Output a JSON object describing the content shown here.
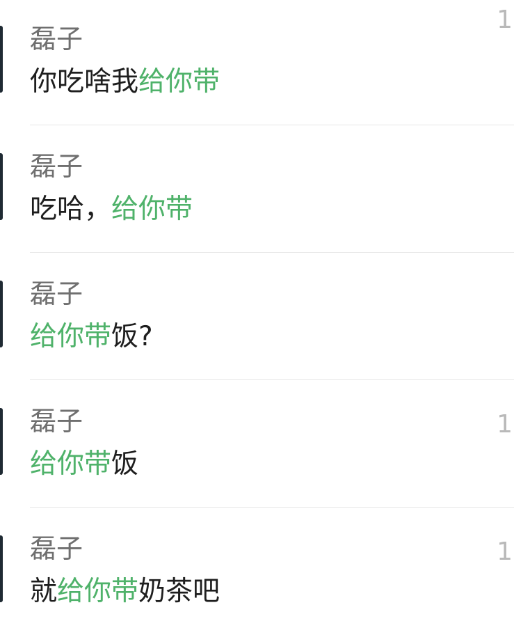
{
  "results": [
    {
      "sender": "磊子",
      "time": "1",
      "segments": [
        {
          "text": "你吃啥我",
          "highlight": false
        },
        {
          "text": "给你带",
          "highlight": true
        }
      ]
    },
    {
      "sender": "磊子",
      "time": "",
      "segments": [
        {
          "text": "吃哈，",
          "highlight": false
        },
        {
          "text": "给你带",
          "highlight": true
        }
      ]
    },
    {
      "sender": "磊子",
      "time": "",
      "segments": [
        {
          "text": "给你带",
          "highlight": true
        },
        {
          "text": "饭?",
          "highlight": false
        }
      ]
    },
    {
      "sender": "磊子",
      "time": "1",
      "segments": [
        {
          "text": "给你带",
          "highlight": true
        },
        {
          "text": "饭",
          "highlight": false
        }
      ]
    },
    {
      "sender": "磊子",
      "time": "1",
      "segments": [
        {
          "text": "就",
          "highlight": false
        },
        {
          "text": "给你带",
          "highlight": true
        },
        {
          "text": "奶茶吧",
          "highlight": false
        }
      ]
    }
  ],
  "colors": {
    "highlight": "#4fb26a",
    "sender": "#6f6f6f",
    "message": "#1e1e1e",
    "divider": "#e6e6e6"
  }
}
